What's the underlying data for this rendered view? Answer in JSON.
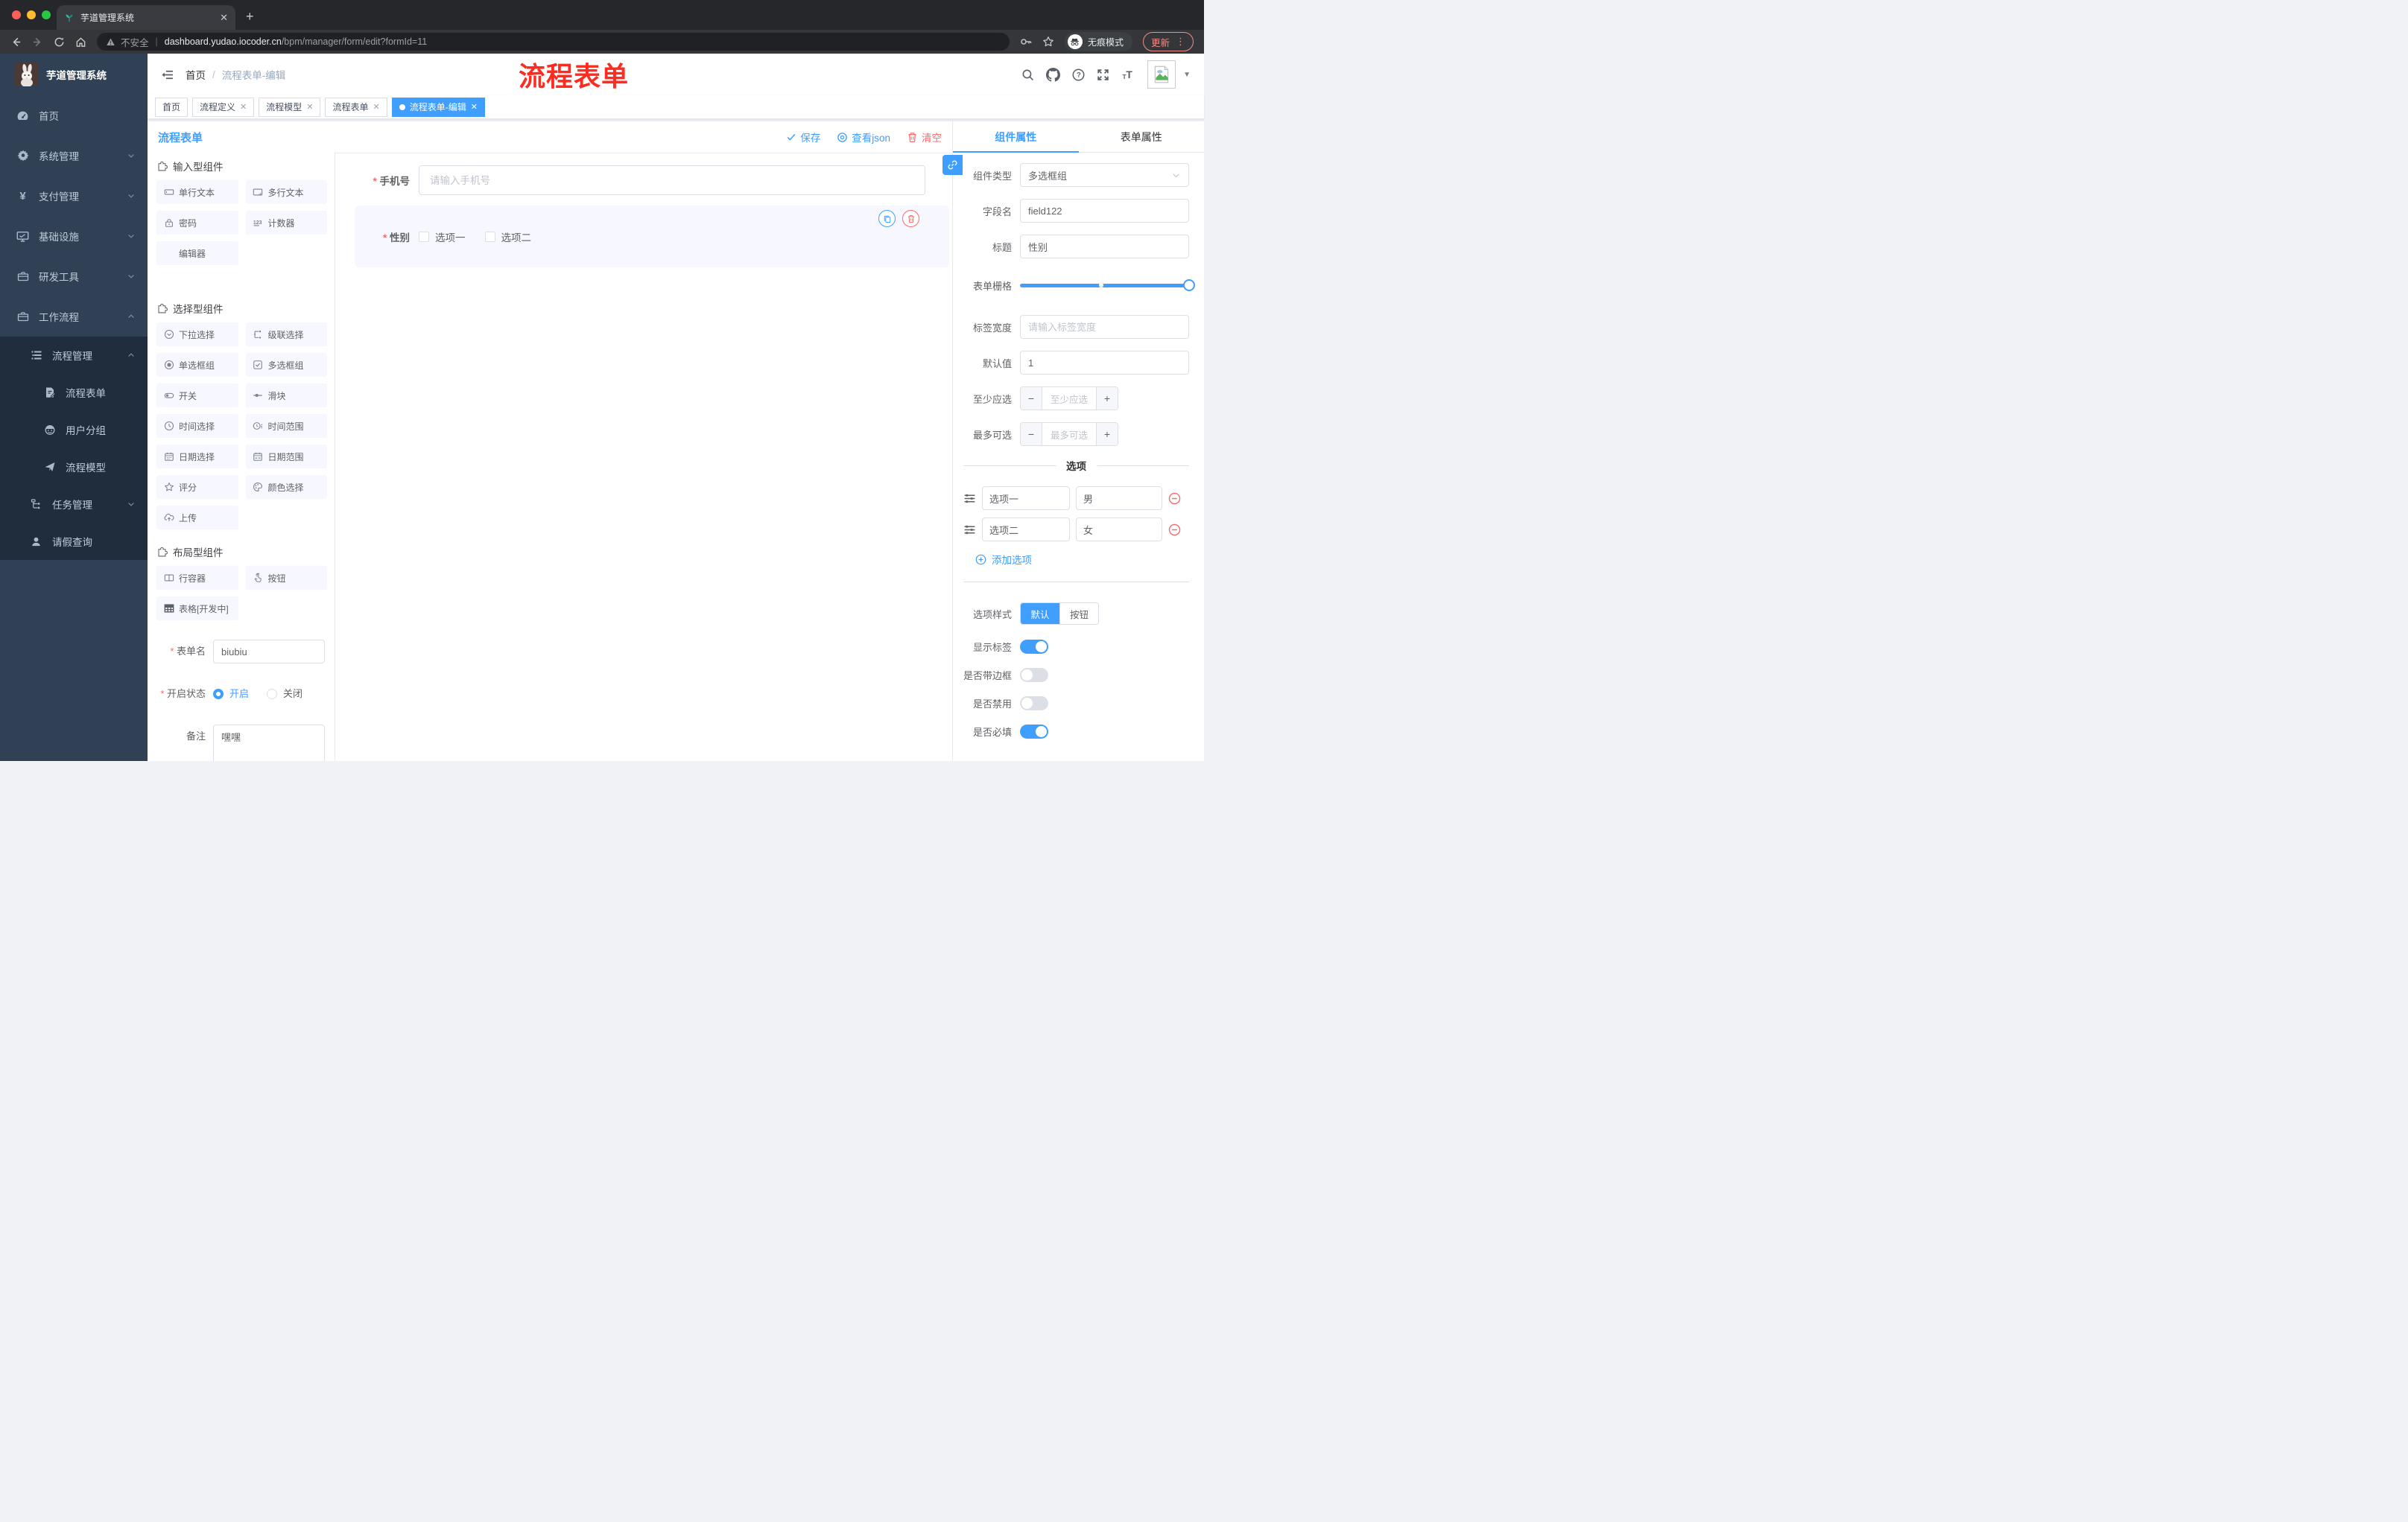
{
  "colors": {
    "accent": "#409eff",
    "danger": "#f56c6c",
    "annotation_red": "#fd2b20",
    "sidebar_bg": "#304156",
    "submenu_bg": "#1f2d3d"
  },
  "chrome": {
    "tab_title": "芋道管理系统",
    "security_label": "不安全",
    "url_host": "dashboard.yudao.iocoder.cn",
    "url_path": "/bpm/manager/form/edit?formId=11",
    "incognito_label": "无痕模式",
    "update_label": "更新"
  },
  "sidebar": {
    "logo_title": "芋道管理系统",
    "menu": [
      {
        "label": "首页"
      },
      {
        "label": "系统管理"
      },
      {
        "label": "支付管理"
      },
      {
        "label": "基础设施"
      },
      {
        "label": "研发工具"
      },
      {
        "label": "工作流程"
      }
    ],
    "submenu": [
      {
        "label": "流程管理"
      },
      {
        "label": "流程表单"
      },
      {
        "label": "用户分组"
      },
      {
        "label": "流程模型"
      },
      {
        "label": "任务管理"
      },
      {
        "label": "请假查询"
      }
    ]
  },
  "header": {
    "breadcrumb_home": "首页",
    "breadcrumb_current": "流程表单-编辑",
    "annotation": "流程表单"
  },
  "tags": [
    {
      "label": "首页"
    },
    {
      "label": "流程定义"
    },
    {
      "label": "流程模型"
    },
    {
      "label": "流程表单"
    },
    {
      "label": "流程表单-编辑"
    }
  ],
  "toolbar": {
    "title": "流程表单",
    "save_label": "保存",
    "view_json_label": "查看json",
    "clear_label": "清空"
  },
  "components": {
    "sections": [
      {
        "title": "输入型组件",
        "items": [
          {
            "label": "单行文本"
          },
          {
            "label": "多行文本"
          },
          {
            "label": "密码"
          },
          {
            "label": "计数器"
          },
          {
            "label": "编辑器"
          }
        ]
      },
      {
        "title": "选择型组件",
        "items": [
          {
            "label": "下拉选择"
          },
          {
            "label": "级联选择"
          },
          {
            "label": "单选框组"
          },
          {
            "label": "多选框组"
          },
          {
            "label": "开关"
          },
          {
            "label": "滑块"
          },
          {
            "label": "时间选择"
          },
          {
            "label": "时间范围"
          },
          {
            "label": "日期选择"
          },
          {
            "label": "日期范围"
          },
          {
            "label": "评分"
          },
          {
            "label": "颜色选择"
          },
          {
            "label": "上传"
          }
        ]
      },
      {
        "title": "布局型组件",
        "items": [
          {
            "label": "行容器"
          },
          {
            "label": "按钮"
          },
          {
            "label": "表格[开发中]"
          }
        ]
      }
    ],
    "form": {
      "name_label": "表单名",
      "name_value": "biubiu",
      "status_label": "开启状态",
      "status_on": "开启",
      "status_off": "关闭",
      "remark_label": "备注",
      "remark_value": "嘿嘿"
    }
  },
  "canvas": {
    "phone": {
      "label": "手机号",
      "placeholder": "请输入手机号"
    },
    "gender": {
      "label": "性别",
      "option1": "选项一",
      "option2": "选项二"
    }
  },
  "props": {
    "tab_component": "组件属性",
    "tab_form": "表单属性",
    "component_type": {
      "label": "组件类型",
      "value": "多选框组"
    },
    "field_name": {
      "label": "字段名",
      "value": "field122"
    },
    "title": {
      "label": "标题",
      "value": "性别"
    },
    "grid": {
      "label": "表单栅格"
    },
    "label_width": {
      "label": "标签宽度",
      "placeholder": "请输入标签宽度"
    },
    "default_value": {
      "label": "默认值",
      "value": "1"
    },
    "min_select": {
      "label": "至少应选",
      "placeholder": "至少应选"
    },
    "max_select": {
      "label": "最多可选",
      "placeholder": "最多可选"
    },
    "options_divider": "选项",
    "options": [
      {
        "label": "选项一",
        "value": "男"
      },
      {
        "label": "选项二",
        "value": "女"
      }
    ],
    "add_option": "添加选项",
    "option_style": {
      "label": "选项样式",
      "default": "默认",
      "button": "按钮"
    },
    "switches": [
      {
        "label": "显示标签"
      },
      {
        "label": "是否带边框"
      },
      {
        "label": "是否禁用"
      },
      {
        "label": "是否必填"
      }
    ]
  }
}
